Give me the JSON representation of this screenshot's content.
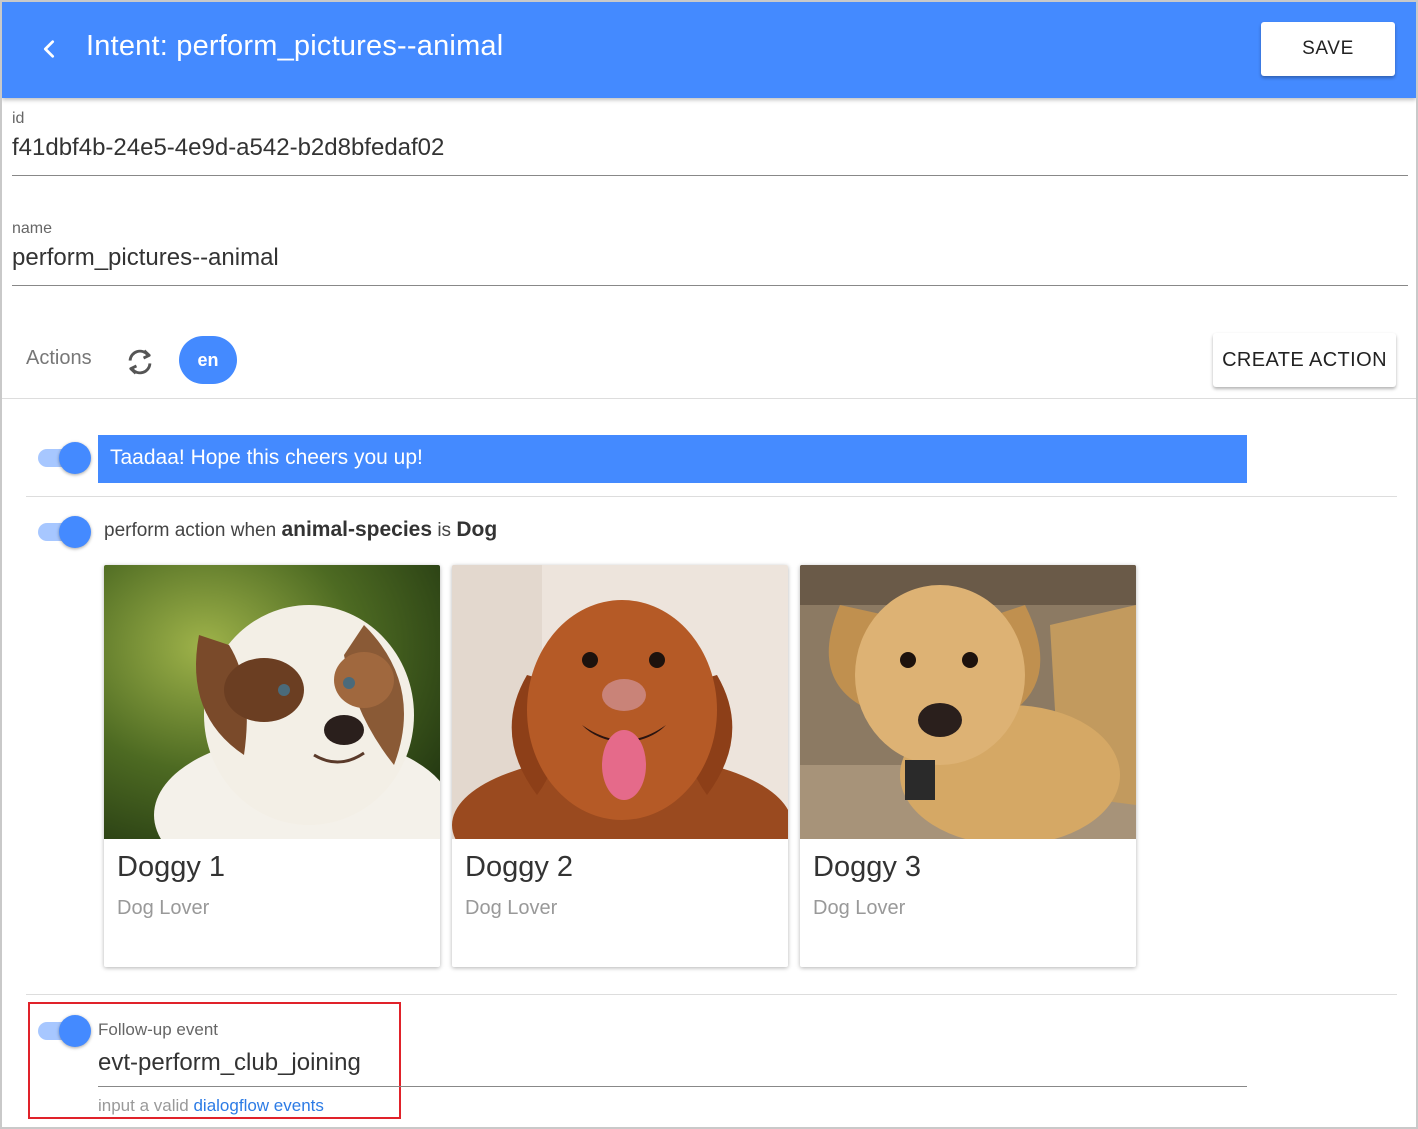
{
  "header": {
    "title": "Intent: perform_pictures--animal",
    "save_label": "SAVE"
  },
  "fields": {
    "id_label": "id",
    "id_value": "f41dbf4b-24e5-4e9d-a542-b2d8bfedaf02",
    "name_label": "name",
    "name_value": "perform_pictures--animal"
  },
  "actions": {
    "label": "Actions",
    "language": "en",
    "create_label": "CREATE ACTION",
    "text_action": "Taadaa! Hope this cheers you up!",
    "condition": {
      "prefix": "perform action when",
      "parameter": "animal-species",
      "connector": "is",
      "value": "Dog"
    },
    "cards": [
      {
        "title": "Doggy 1",
        "subtitle": "Dog Lover"
      },
      {
        "title": "Doggy 2",
        "subtitle": "Dog Lover"
      },
      {
        "title": "Doggy 3",
        "subtitle": "Dog Lover"
      }
    ],
    "followup": {
      "label": "Follow-up event",
      "value": "evt-perform_club_joining",
      "hint_prefix": "input a valid",
      "hint_link": "dialogflow events"
    }
  },
  "colors": {
    "primary": "#448aff",
    "toggle_track": "#a7c7ff",
    "highlight_border": "#e0222a",
    "link": "#2c7be5"
  },
  "icons": [
    "chevron-left-icon",
    "sync-icon"
  ]
}
